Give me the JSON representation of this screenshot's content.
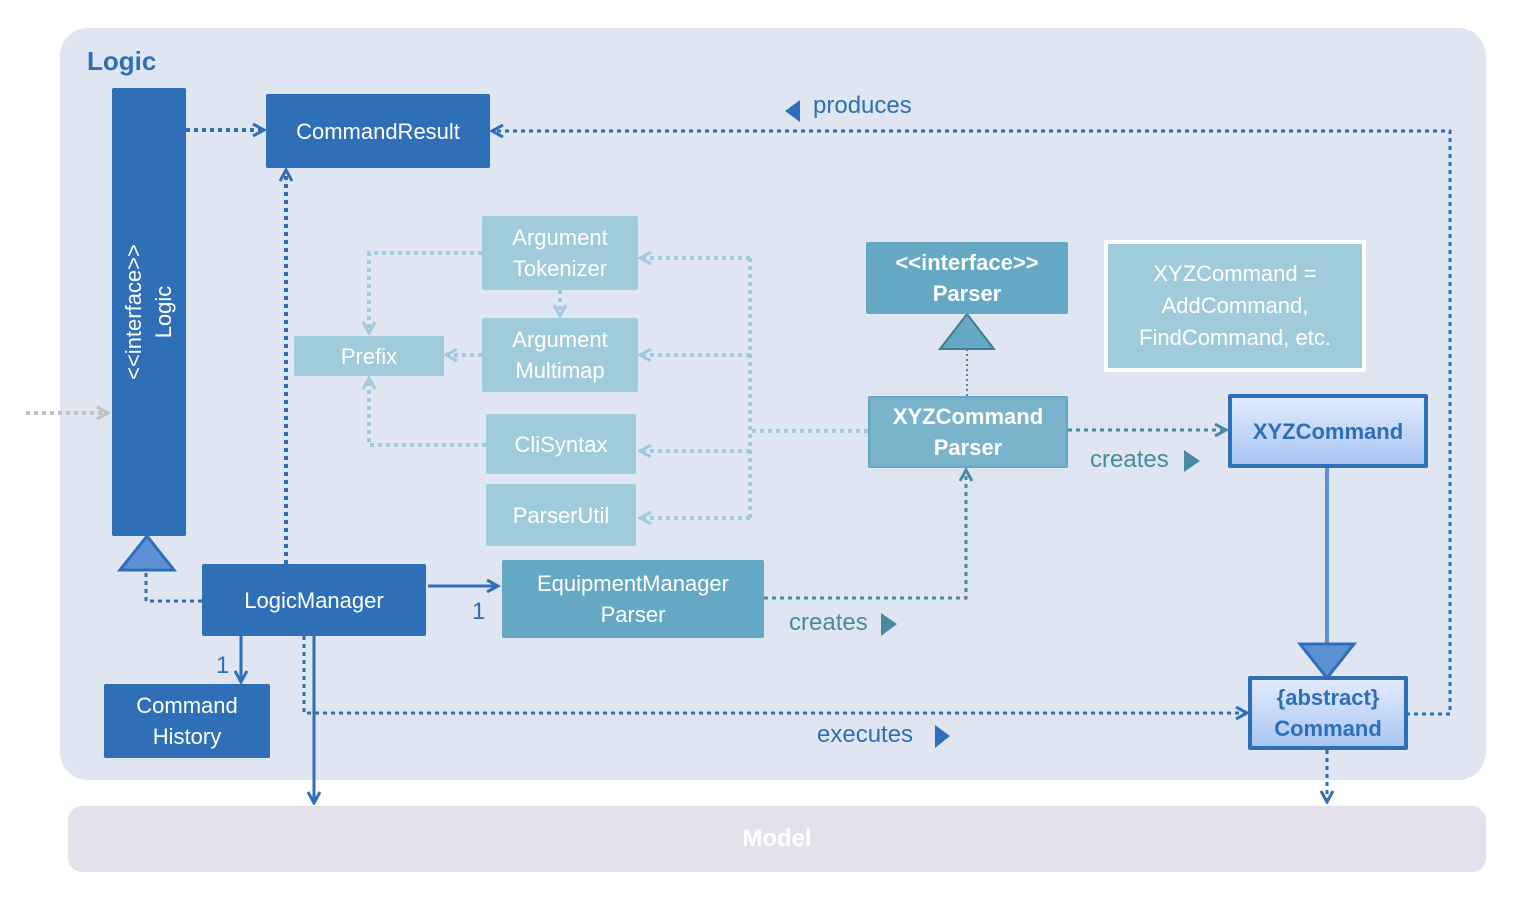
{
  "packages": {
    "logic": {
      "title": "Logic"
    },
    "model": {
      "title": "Model"
    }
  },
  "classes": {
    "logic_interface": {
      "stereotype": "<<interface>>",
      "name": "Logic"
    },
    "command_result": {
      "name": "CommandResult"
    },
    "argument_tokenizer": {
      "line1": "Argument",
      "line2": "Tokenizer"
    },
    "argument_multimap": {
      "line1": "Argument",
      "line2": "Multimap"
    },
    "prefix": {
      "name": "Prefix"
    },
    "cli_syntax": {
      "name": "CliSyntax"
    },
    "parser_util": {
      "name": "ParserUtil"
    },
    "parser_interface": {
      "stereotype": "<<interface>>",
      "name": "Parser"
    },
    "xyz_command_parser": {
      "line1": "XYZCommand",
      "line2": "Parser"
    },
    "xyz_command": {
      "name": "XYZCommand"
    },
    "abstract_command": {
      "stereotype": "{abstract}",
      "name": "Command"
    },
    "logic_manager": {
      "name": "LogicManager"
    },
    "equipment_manager_parser": {
      "line1": "EquipmentManager",
      "line2": "Parser"
    },
    "command_history": {
      "line1": "Command",
      "line2": "History"
    }
  },
  "note": {
    "line1": "XYZCommand =",
    "line2": "AddCommand,",
    "line3": "FindCommand, etc."
  },
  "edge_labels": {
    "produces": "produces",
    "creates_1": "creates",
    "creates_2": "creates",
    "executes": "executes",
    "mult_parser": "1",
    "mult_history": "1"
  },
  "colors": {
    "dark_blue": "#2e6fb8",
    "mid_teal": "#64a8c3",
    "light_teal": "#a0cbdb",
    "package_bg": "#dfe6f1",
    "model_bg": "#e4e0ec"
  }
}
